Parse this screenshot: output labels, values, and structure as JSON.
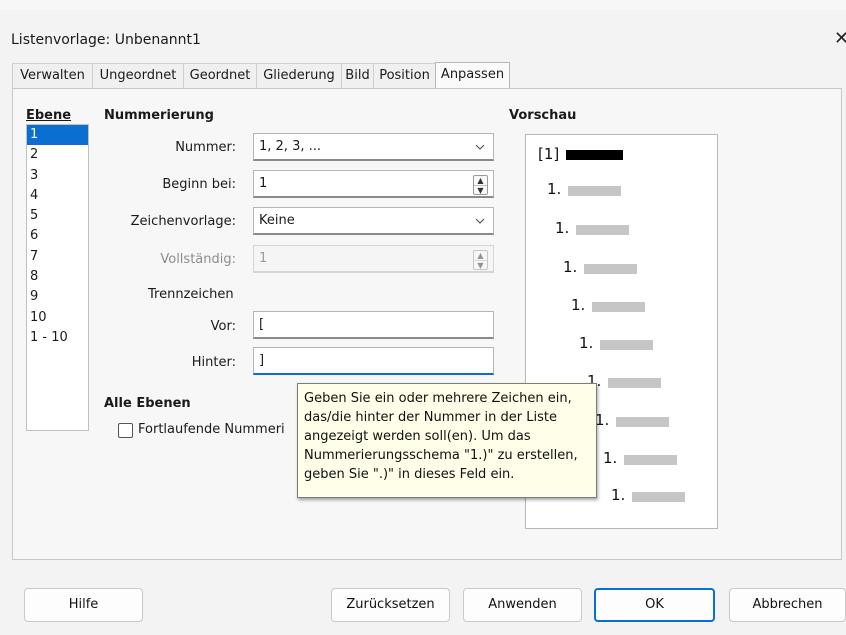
{
  "window": {
    "title": "Listenvorlage: Unbenannt1",
    "close_glyph": "✕"
  },
  "tabs": [
    {
      "label": "Verwalten"
    },
    {
      "label": "Ungeordnet"
    },
    {
      "label": "Geordnet"
    },
    {
      "label": "Gliederung"
    },
    {
      "label": "Bild"
    },
    {
      "label": "Position"
    },
    {
      "label": "Anpassen",
      "active": true
    }
  ],
  "level": {
    "heading": "Ebene",
    "items": [
      "1",
      "2",
      "3",
      "4",
      "5",
      "6",
      "7",
      "8",
      "9",
      "10",
      "1 - 10"
    ],
    "selected": "1"
  },
  "numbering": {
    "heading": "Nummerierung",
    "number_label": "Nummer:",
    "number_value": "1, 2, 3, ...",
    "start_label": "Beginn bei:",
    "start_value": "1",
    "charstyle_label": "Zeichenvorlage:",
    "charstyle_value": "Keine",
    "complete_label": "Vollständig:",
    "complete_value": "1",
    "separator_label": "Trennzeichen",
    "before_label": "Vor:",
    "before_value": "[",
    "after_label": "Hinter:",
    "after_value": "]"
  },
  "all_levels": {
    "heading": "Alle Ebenen",
    "consecutive_label": "Fortlaufende Nummeri",
    "consecutive_checked": false
  },
  "preview": {
    "heading": "Vorschau",
    "first_label": "[1]",
    "item_label": "1."
  },
  "tooltip": {
    "lines": [
      "Geben Sie ein oder mehrere Zeichen ein,",
      "das/die hinter der Nummer in der Liste",
      "angezeigt werden soll(en). Um das",
      "Nummerierungsschema \"1.)\" zu erstellen,",
      "geben Sie \".)\" in dieses Feld ein."
    ]
  },
  "buttons": {
    "help": "Hilfe",
    "reset": "Zurücksetzen",
    "apply": "Anwenden",
    "ok": "OK",
    "cancel": "Abbrechen"
  },
  "colors": {
    "accent": "#0a6fd1",
    "tooltip_bg": "#fffee8"
  }
}
